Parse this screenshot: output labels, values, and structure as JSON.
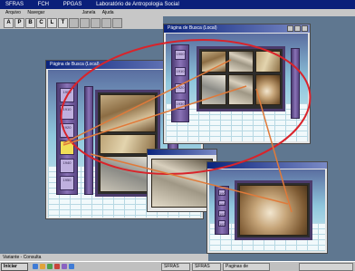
{
  "app": {
    "title_parts": [
      "SFRAS",
      "FCH",
      "PPGAS",
      "Laboratório de Antropologia Social"
    ],
    "menu": [
      "Arquivo",
      "Navegar",
      "Janela",
      "Ajuda"
    ],
    "toolbar_letters": [
      "A",
      "P",
      "B",
      "C",
      "L",
      "T"
    ]
  },
  "windows": {
    "main": {
      "title": "Página de Busca (Local)"
    },
    "top_right": {
      "title": "Página de Busca (Local)"
    }
  },
  "pillar_tabs": {
    "main": [
      "1900",
      "1910",
      "1920",
      "",
      "1940",
      "1950"
    ],
    "top_right": [
      "1900",
      "1910",
      "1920",
      "1930"
    ],
    "bottom_right": [
      "1900",
      "1910",
      "1920",
      "1930"
    ]
  },
  "statusbar": {
    "label": "Variante - Consulta"
  },
  "taskbar": {
    "start_label": "Iniciar",
    "tasks": [
      "SFRAS",
      "SFRAS",
      "Paginas de"
    ],
    "tray_text": ""
  },
  "colors": {
    "annotation_red": "#d9232a",
    "annotation_arrow": "#e07a3a",
    "titlebar": "#0a1f7a",
    "pillar_purple": "#5a4584"
  }
}
